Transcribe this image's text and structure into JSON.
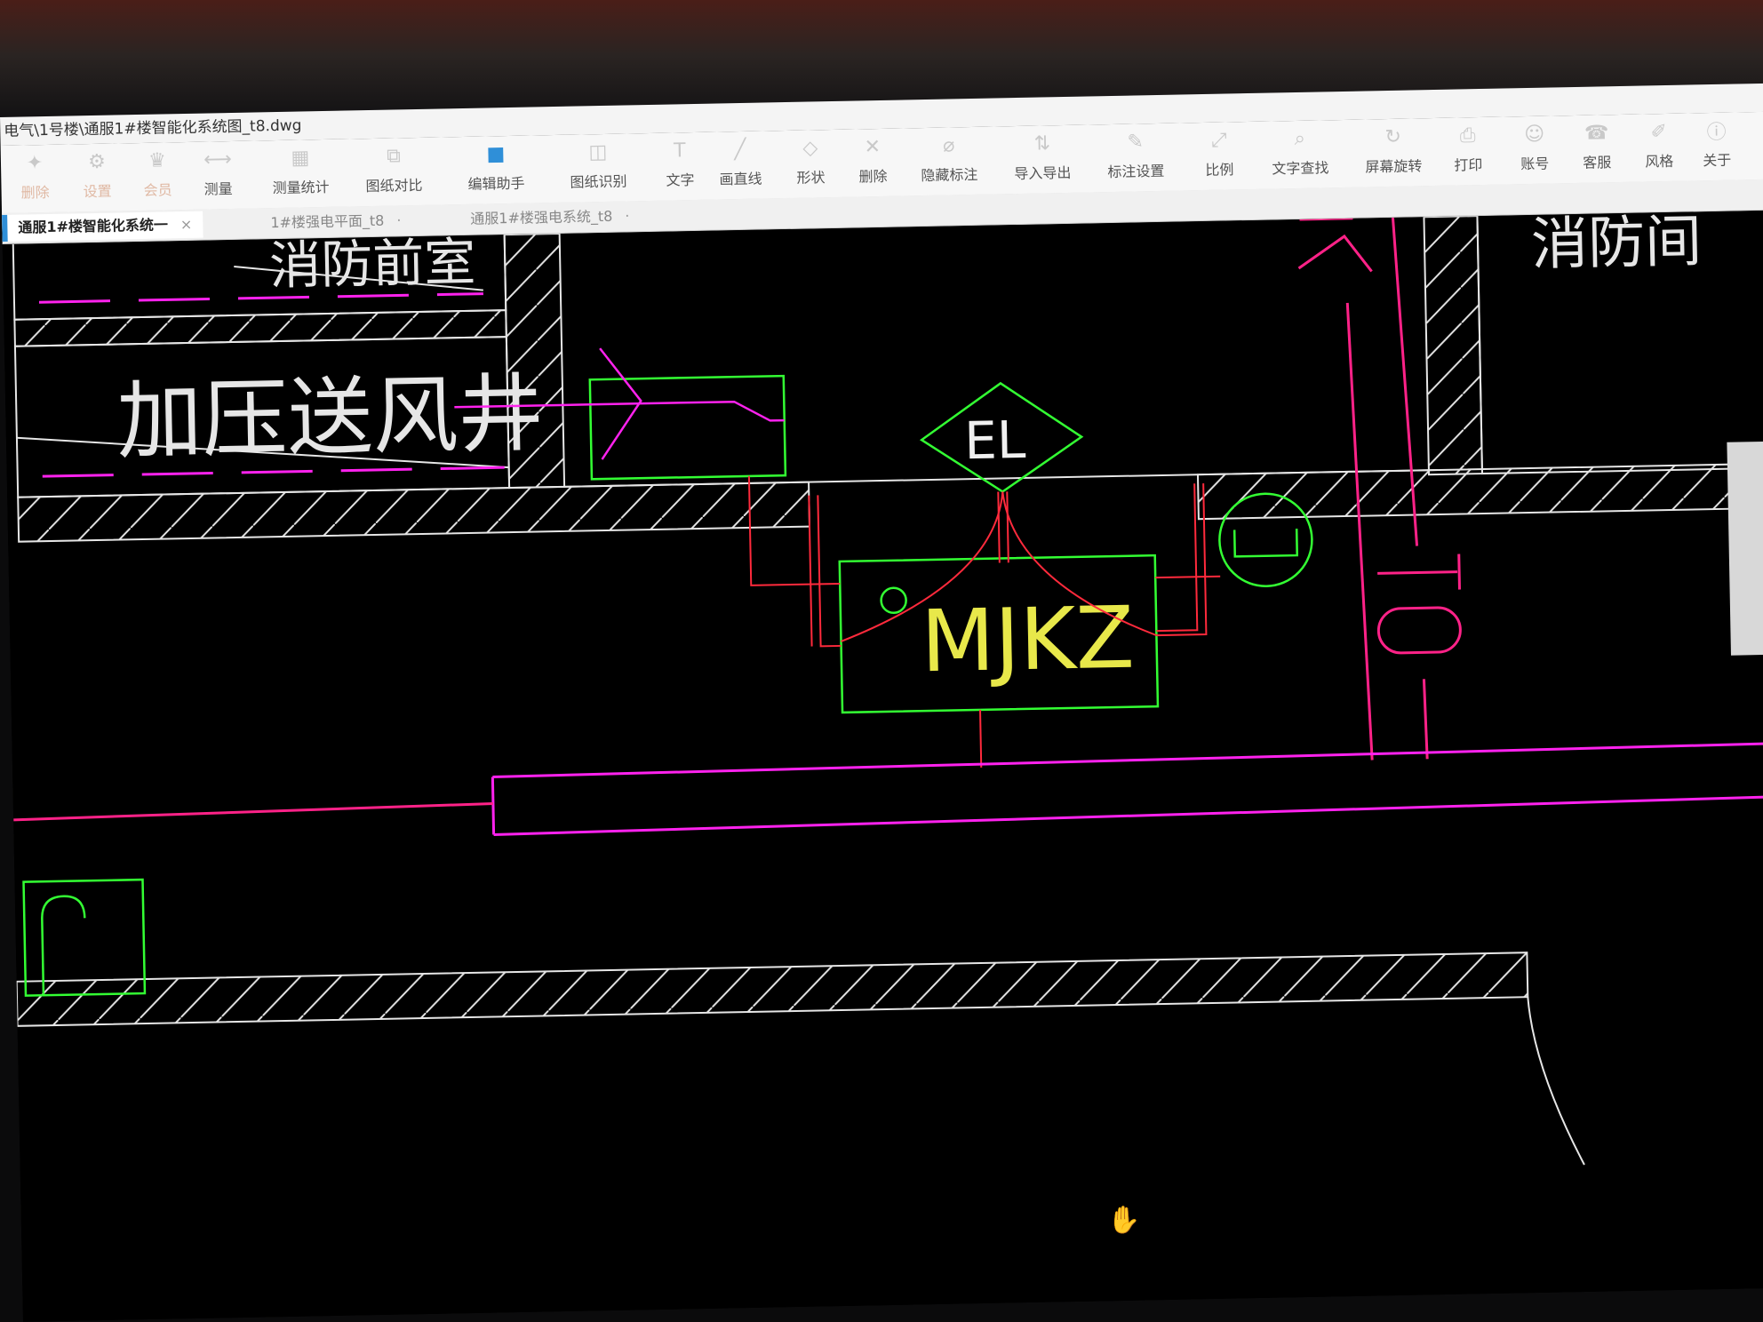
{
  "window": {
    "title": "电气\\1号楼\\通服1#楼智能化系统图_t8.dwg"
  },
  "toolbar": {
    "items": [
      {
        "label": "删除",
        "icon": "delete-icon"
      },
      {
        "label": "设置",
        "icon": "settings-icon"
      },
      {
        "label": "会员",
        "icon": "vip-icon"
      },
      {
        "label": "测量",
        "icon": "measure-icon"
      },
      {
        "label": "测量统计",
        "icon": "measure-stats-icon"
      },
      {
        "label": "图纸对比",
        "icon": "compare-icon"
      },
      {
        "label": "编辑助手",
        "icon": "edit-assistant-icon"
      },
      {
        "label": "图纸识别",
        "icon": "recognize-icon"
      },
      {
        "label": "文字",
        "icon": "text-icon"
      },
      {
        "label": "画直线",
        "icon": "line-icon"
      },
      {
        "label": "形状",
        "icon": "shape-icon"
      },
      {
        "label": "删除",
        "icon": "erase-icon"
      },
      {
        "label": "隐藏标注",
        "icon": "hide-annotation-icon"
      },
      {
        "label": "导入导出",
        "icon": "import-export-icon"
      },
      {
        "label": "标注设置",
        "icon": "annotation-settings-icon"
      },
      {
        "label": "比例",
        "icon": "scale-icon"
      },
      {
        "label": "文字查找",
        "icon": "text-search-icon"
      },
      {
        "label": "屏幕旋转",
        "icon": "rotate-screen-icon"
      },
      {
        "label": "打印",
        "icon": "print-icon"
      },
      {
        "label": "账号",
        "icon": "account-icon"
      },
      {
        "label": "客服",
        "icon": "support-icon"
      },
      {
        "label": "风格",
        "icon": "style-icon"
      },
      {
        "label": "关于",
        "icon": "about-icon"
      }
    ]
  },
  "tabs": [
    {
      "label": "通服1#楼智能化系统一",
      "close": "×",
      "active": true
    },
    {
      "label": "1#楼强电平面_t8",
      "close": "·",
      "active": false
    },
    {
      "label": "通服1#楼强电系统_t8",
      "close": "·",
      "active": false
    }
  ],
  "drawing": {
    "room_label": "加压送风井",
    "room_label_top": "消防前室",
    "room_label_right": "消防间",
    "device_el": "EL",
    "device_mjkz": "MJKZ",
    "colors": {
      "wall": "#e6e6e6",
      "magenta": "#ff22ee",
      "green": "#33ff33",
      "red": "#ff2255",
      "yellow": "#e8e84a",
      "cable": "#ff2a3c"
    }
  }
}
